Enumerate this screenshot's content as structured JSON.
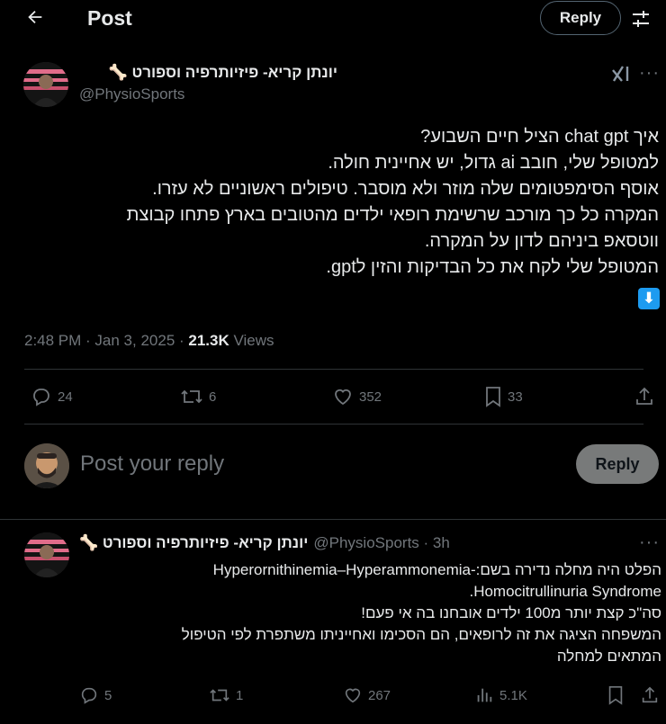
{
  "header": {
    "title": "Post",
    "reply_label": "Reply"
  },
  "post": {
    "author_name": "יונתן קריא- פיזיותרפיה וספורט",
    "author_emoji": "🦴",
    "handle": "@PhysioSports",
    "lines": [
      "איך chat gpt הציל חיים השבוע?",
      "למטופל שלי, חובב ai גדול, יש אחיינית חולה.",
      "אוסף הסימפטומים שלה מוזר ולא מוסבר. טיפולים ראשוניים לא עזרו.",
      "המקרה כל כך מורכב שרשימת רופאי ילדים מהטובים בארץ פתחו קבוצת",
      "ווטסאפ ביניהם לדון על המקרה.",
      "המטופל שלי לקח את כל הבדיקות והזין לgpt."
    ],
    "emoji_arrow": "⬇",
    "time": "2:48 PM · Jan 3, 2025 · ",
    "views_count": "21.3K",
    "views_label": " Views",
    "actions": {
      "replies": "24",
      "reposts": "6",
      "likes": "352",
      "bookmarks": "33"
    }
  },
  "reply_composer": {
    "placeholder": "Post your reply",
    "button_label": "Reply"
  },
  "reply": {
    "author_name": "יונתן קריא- פיזיותרפיה וספורט",
    "author_emoji": "🦴",
    "handle_time": "@PhysioSports · 3h",
    "lines": [
      "הפלט היה מחלה נדירה בשם:-Hyperornithinemia–Hyperammonemia",
      "Homocitrullinuria Syndrome.",
      "סה\"כ קצת יותר מ100 ילדים אובחנו בה אי פעם!",
      "המשפחה הציגה את זה לרופאים, הם הסכימו ואחייניתו משתפרת לפי הטיפול",
      "המתאים למחלה"
    ],
    "actions": {
      "replies": "5",
      "reposts": "1",
      "likes": "267",
      "views": "5.1K"
    }
  }
}
